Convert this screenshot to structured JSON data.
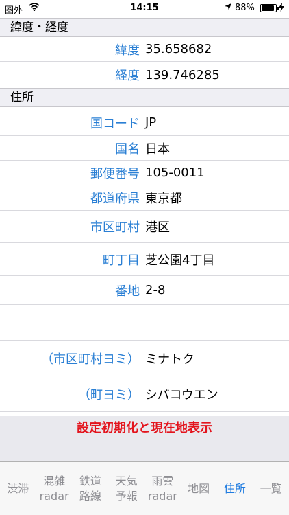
{
  "status_bar": {
    "carrier": "圏外",
    "time": "14:15",
    "battery_percent": "88%",
    "battery_level": 0.88
  },
  "sections": {
    "coordinates": {
      "header": "緯度・経度",
      "latitude_label": "緯度",
      "latitude_value": "35.658682",
      "longitude_label": "経度",
      "longitude_value": "139.746285"
    },
    "address": {
      "header": "住所",
      "rows": [
        {
          "label": "国コード",
          "value": "JP"
        },
        {
          "label": "国名",
          "value": "日本"
        },
        {
          "label": "郵便番号",
          "value": "105-0011"
        },
        {
          "label": "都道府県",
          "value": "東京都"
        },
        {
          "label": "市区町村",
          "value": "港区"
        },
        {
          "label": "町丁目",
          "value": "芝公園4丁目"
        },
        {
          "label": "番地",
          "value": "2-8"
        },
        {
          "label": "",
          "value": ""
        },
        {
          "label": "（市区町村ヨミ）",
          "value": "ミナトク"
        },
        {
          "label": "（町ヨミ）",
          "value": "シバコウエン"
        }
      ]
    }
  },
  "reset_button": "設定初期化と現在地表示",
  "tabs": [
    {
      "label": "渋滞"
    },
    {
      "label": "混雑\nradar"
    },
    {
      "label": "鉄道\n路線"
    },
    {
      "label": "天気\n予報"
    },
    {
      "label": "雨雲\nradar"
    },
    {
      "label": "地図"
    },
    {
      "label": "住所",
      "active": true
    },
    {
      "label": "一覧"
    }
  ],
  "colors": {
    "label_blue": "#2a7fd4",
    "reset_red": "#e3141d",
    "tab_active": "#1e7be0",
    "tab_inactive": "#8e8e93",
    "section_bg": "#efeff4"
  }
}
